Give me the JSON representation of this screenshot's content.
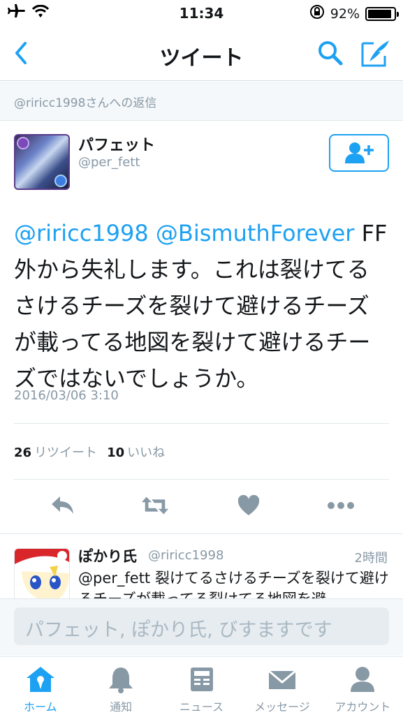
{
  "status_bar": {
    "time": "11:34",
    "battery": "92%",
    "battery_level": 0.92
  },
  "nav": {
    "title": "ツイート"
  },
  "reply_banner": "@riricc1998さんへの返信",
  "tweet": {
    "name": "パフェット",
    "handle": "@per_fett",
    "mention1": "@riricc1998",
    "mention2": "@BismuthForever",
    "text": "FF外から失礼します。これは裂けてるさけるチーズを裂けて避けるチーズが載ってる地図を裂けて避けるチーズではないでしょうか。",
    "timestamp": "2016/03/06 3:10",
    "retweet_count": "26",
    "retweet_label": "リツイート",
    "like_count": "10",
    "like_label": "いいね"
  },
  "reply": {
    "name": "ぽかり氏",
    "handle": "@riricc1998",
    "time": "2時間",
    "mention": "@per_fett",
    "text": "裂けてるさけるチーズを裂けて避けるチーズが載ってる裂けてる地図を避"
  },
  "compose": {
    "placeholder": "パフェット, ぽかり氏, びすますです"
  },
  "tabs": [
    {
      "label": "ホーム",
      "icon": "home-icon",
      "active": true
    },
    {
      "label": "通知",
      "icon": "bell-icon",
      "active": false
    },
    {
      "label": "ニュース",
      "icon": "news-icon",
      "active": false
    },
    {
      "label": "メッセージ",
      "icon": "envelope-icon",
      "active": false
    },
    {
      "label": "アカウント",
      "icon": "person-icon",
      "active": false
    }
  ],
  "colors": {
    "accent": "#1da1f2",
    "secondary": "#8899a6",
    "icon_gray": "#8899a6"
  }
}
